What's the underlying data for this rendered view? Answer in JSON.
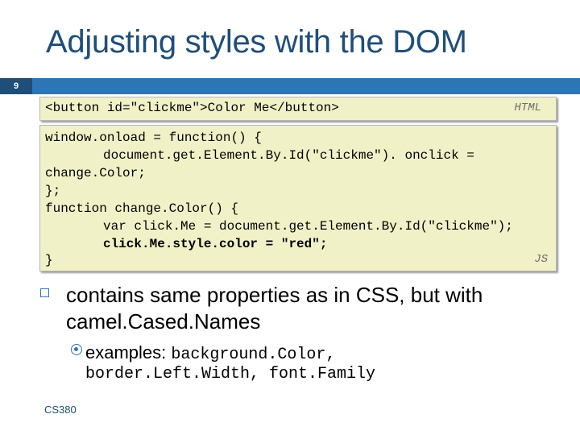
{
  "slide": {
    "title": "Adjusting styles with the DOM",
    "number": "9",
    "footer": "CS380"
  },
  "html_code": {
    "line": "<button id=\"clickme\">Color Me</button>",
    "tag": "HTML"
  },
  "js_code": {
    "lines": [
      "window.onload = function() {",
      "\tdocument.get.Element.By.Id(\"clickme\"). onclick =",
      "change.Color;",
      "};",
      "function change.Color() {",
      "\tvar click.Me = document.get.Element.By.Id(\"clickme\");",
      "\tclick.Me.style.color = \"red\";",
      "}"
    ],
    "tag": "JS"
  },
  "bullets": {
    "main": "contains same properties as in CSS, but with camel.Cased.Names",
    "sub_label": "examples:",
    "sub_code_1": "background.Color,",
    "sub_code_2": "border.Left.Width, font.Family"
  },
  "colors": {
    "title": "#1f4e79",
    "bar": "#2e75b6",
    "code_bg": "#f1f1c8"
  }
}
